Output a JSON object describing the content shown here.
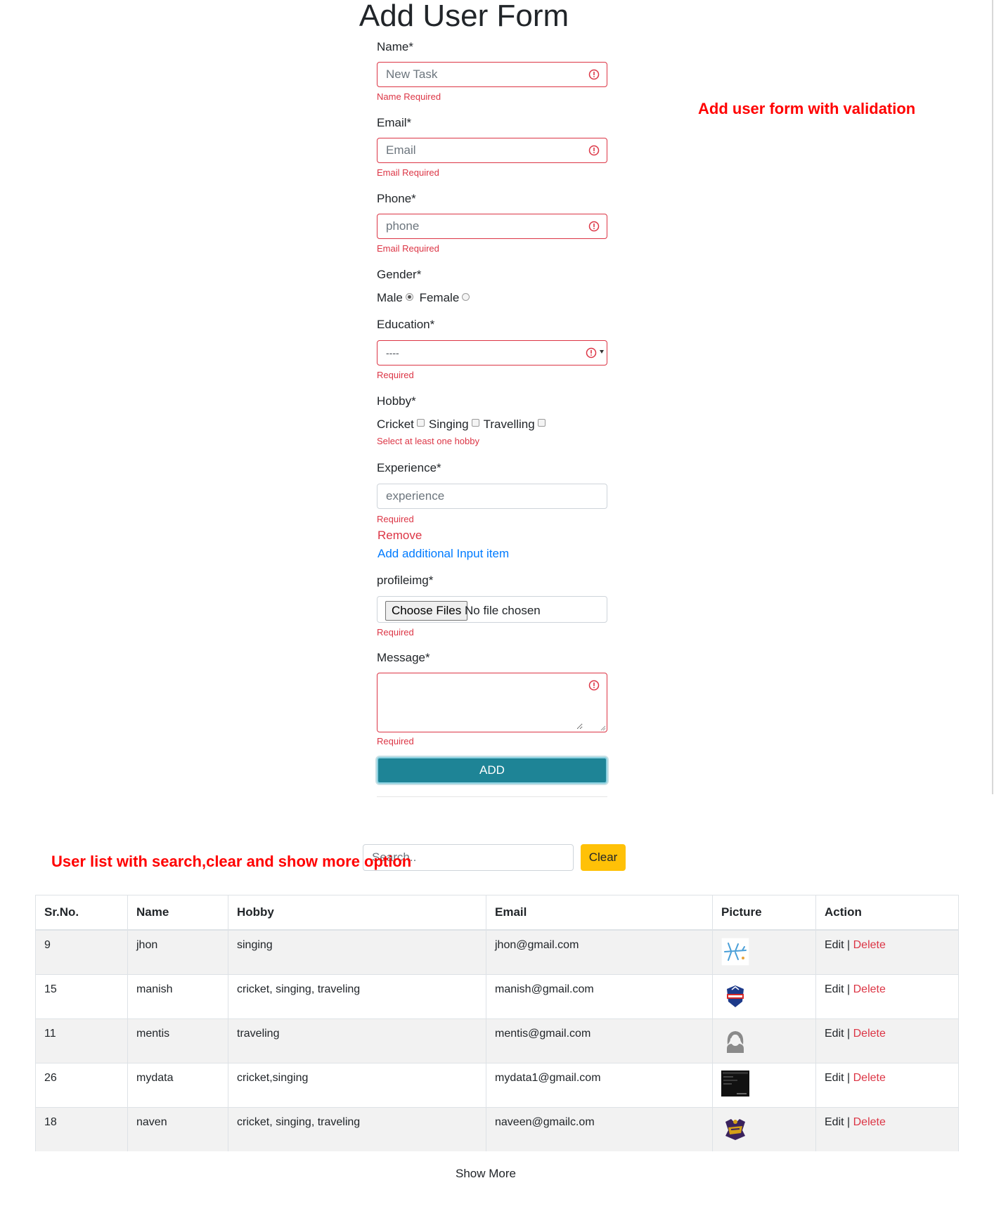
{
  "page": {
    "title": "Add User Form"
  },
  "notes": {
    "form_note": "Add user form with validation",
    "list_note": "User list with search,clear and show more option"
  },
  "colors": {
    "error": "#dc3545",
    "primary_button": "#1e8496",
    "clear_button": "#ffc107",
    "note": "#ff0000"
  },
  "form": {
    "name": {
      "label": "Name*",
      "placeholder": "New Task",
      "error": "Name Required"
    },
    "email": {
      "label": "Email*",
      "placeholder": "Email",
      "error": "Email Required"
    },
    "phone": {
      "label": "Phone*",
      "placeholder": "phone",
      "error": "Email Required"
    },
    "gender": {
      "label": "Gender*",
      "options": [
        "Male",
        "Female"
      ],
      "selected": "Male"
    },
    "education": {
      "label": "Education*",
      "selected": "----",
      "error": "Required"
    },
    "hobby": {
      "label": "Hobby*",
      "options": [
        "Cricket",
        "Singing",
        "Travelling"
      ],
      "error": "Select at least one hobby"
    },
    "experience": {
      "label": "Experience*",
      "placeholder": "experience",
      "error": "Required",
      "remove": "Remove",
      "add_more": "Add additional Input item"
    },
    "profileimg": {
      "label": "profileimg*",
      "button": "Choose Files",
      "status": "No file chosen",
      "error": "Required"
    },
    "message": {
      "label": "Message*",
      "error": "Required"
    },
    "submit": "ADD"
  },
  "list": {
    "search_placeholder": "Search..",
    "clear": "Clear",
    "columns": [
      "Sr.No.",
      "Name",
      "Hobby",
      "Email",
      "Picture",
      "Action"
    ],
    "rows": [
      {
        "sr": "9",
        "name": "jhon",
        "hobby": "singing",
        "email": "jhon@gmail.com",
        "picture": "airplane-icon"
      },
      {
        "sr": "15",
        "name": "manish",
        "hobby": "cricket, singing, traveling",
        "email": "manish@gmail.com",
        "picture": "delhi-capitals-logo"
      },
      {
        "sr": "11",
        "name": "mentis",
        "hobby": "traveling",
        "email": "mentis@gmail.com",
        "picture": "female-avatar-icon"
      },
      {
        "sr": "26",
        "name": "mydata",
        "hobby": "cricket,singing",
        "email": "mydata1@gmail.com",
        "picture": "screenshot-thumbnail"
      },
      {
        "sr": "18",
        "name": "naven",
        "hobby": "cricket, singing, traveling",
        "email": "naveen@gmailc.om",
        "picture": "knight-riders-logo"
      }
    ],
    "edit": "Edit",
    "separator": " | ",
    "delete": "Delete",
    "show_more": "Show More"
  }
}
